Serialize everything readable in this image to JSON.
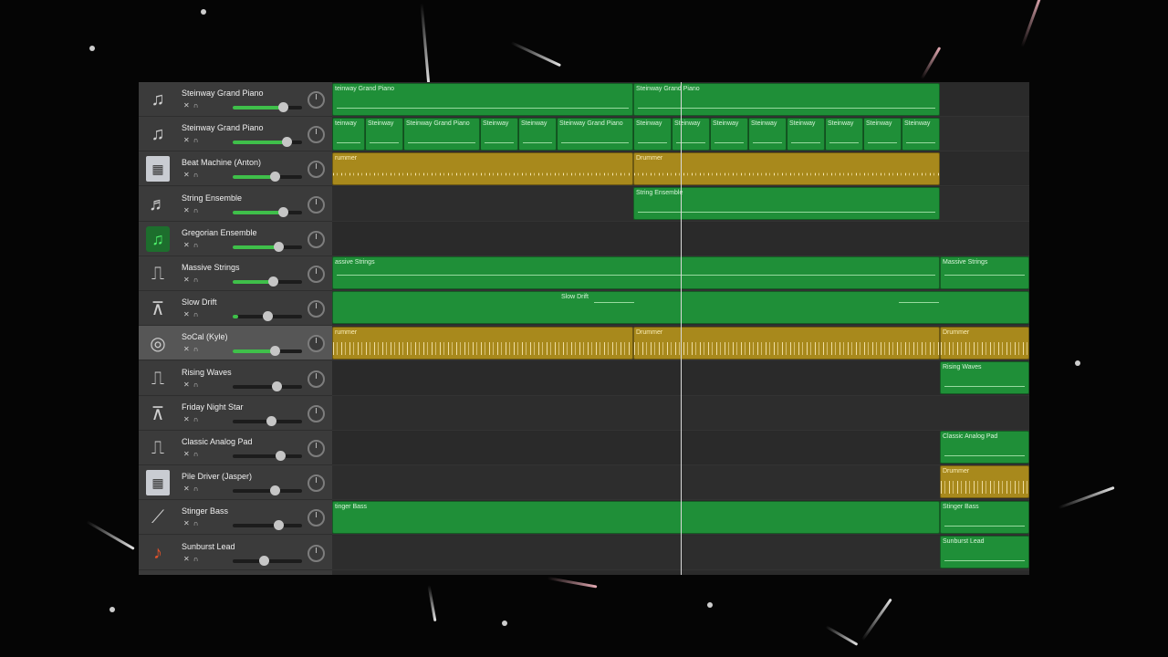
{
  "tracks": [
    {
      "name": "Steinway Grand Piano",
      "icon": "grand-piano-icon",
      "volume": 0.72,
      "selected": false
    },
    {
      "name": "Steinway Grand Piano",
      "icon": "grand-piano-icon",
      "volume": 0.77,
      "selected": false
    },
    {
      "name": "Beat Machine (Anton)",
      "icon": "drum-machine-icon",
      "volume": 0.6,
      "selected": false
    },
    {
      "name": "String Ensemble",
      "icon": "strings-icon",
      "volume": 0.72,
      "selected": false
    },
    {
      "name": "Gregorian Ensemble",
      "icon": "music-note-icon",
      "volume": 0.66,
      "selected": false
    },
    {
      "name": "Massive Strings",
      "icon": "synth-keyboard-icon",
      "volume": 0.58,
      "selected": false
    },
    {
      "name": "Slow Drift",
      "icon": "keyboard-stand-icon",
      "volume": 0.5,
      "selected": false
    },
    {
      "name": "SoCal (Kyle)",
      "icon": "drum-kit-icon",
      "volume": 0.6,
      "selected": true
    },
    {
      "name": "Rising Waves",
      "icon": "synth-keyboard-icon",
      "volume": 0.63,
      "selected": false
    },
    {
      "name": "Friday Night Star",
      "icon": "keyboard-stand-icon",
      "volume": 0.55,
      "selected": false
    },
    {
      "name": "Classic Analog Pad",
      "icon": "synth-keyboard-icon",
      "volume": 0.69,
      "selected": false
    },
    {
      "name": "Pile Driver (Jasper)",
      "icon": "drum-machine-icon",
      "volume": 0.61,
      "selected": false
    },
    {
      "name": "Stinger Bass",
      "icon": "bass-guitar-icon",
      "volume": 0.66,
      "selected": false
    },
    {
      "name": "Sunburst Lead",
      "icon": "electric-guitar-icon",
      "volume": 0.45,
      "selected": false
    }
  ],
  "regions": {
    "r0a": "teinway Grand Piano",
    "r0b": "Steinway Grand Piano",
    "r1": [
      "teinway",
      "Steinway",
      "Steinway Grand Piano",
      "Steinway",
      "Steinway",
      "Steinway Grand Piano",
      "Steinway",
      "Steinway",
      "Steinway",
      "Steinway",
      "Steinway",
      "Steinway",
      "Steinway",
      "Steinway"
    ],
    "r2a": "rummer",
    "r2b": "Drummer",
    "r3": "String Ensemble",
    "r5a": "assive Strings",
    "r5b": "Massive Strings",
    "r6": "Slow Drift",
    "r7a": "rummer",
    "r7b": "Drummer",
    "r7c": "Drummer",
    "r8": "Rising Waves",
    "r10": "Classic Analog Pad",
    "r11": "Drummer",
    "r12a": "tinger Bass",
    "r12b": "Stinger Bass",
    "r13": "Sunburst Lead"
  },
  "colors": {
    "midi_region": "#1f8f38",
    "drummer_region": "#a8891c",
    "volume_fill": "#3fbf4a"
  }
}
